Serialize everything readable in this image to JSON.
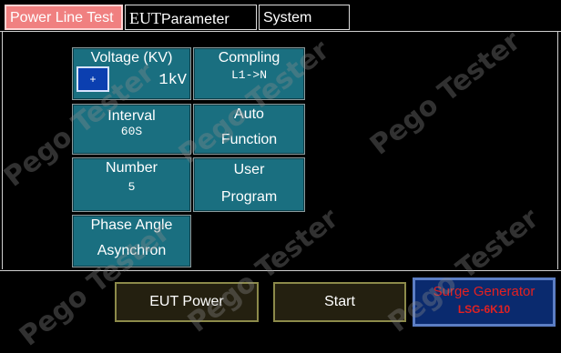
{
  "tabs": [
    {
      "label": "Power Line Test"
    },
    {
      "label_prefix": "EUT",
      "label_suffix": "Parameter"
    },
    {
      "label": "System"
    }
  ],
  "tiles": {
    "voltage": {
      "title": "Voltage (KV)",
      "value": "1kV",
      "button": "+"
    },
    "coupling": {
      "title": "Compling",
      "value": "L1->N"
    },
    "interval": {
      "title": "Interval",
      "value": "60S"
    },
    "auto": {
      "line1": "Auto",
      "line2": "Function"
    },
    "number": {
      "title": "Number",
      "value": "5"
    },
    "user": {
      "line1": "User",
      "line2": "Program"
    },
    "phase": {
      "title": "Phase Angle",
      "value": "Asynchron"
    }
  },
  "buttons": {
    "eut_power": "EUT Power",
    "start": "Start"
  },
  "generator": {
    "title": "Surge Generator",
    "model": "LSG-6K10"
  },
  "watermark": "Pego Tester",
  "colors": {
    "tile": "#1a6f80",
    "active_tab": "#f08080",
    "generator_bg": "#0a2a6e",
    "generator_text": "#e32121"
  }
}
